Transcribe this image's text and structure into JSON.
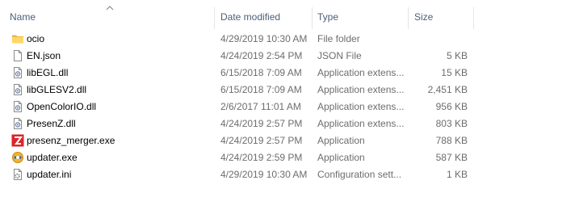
{
  "columns": {
    "name": "Name",
    "date_modified": "Date modified",
    "type": "Type",
    "size": "Size",
    "sorted_by": "Name",
    "sort_direction": "ascending"
  },
  "files": [
    {
      "name": "ocio",
      "date": "4/29/2019 10:30 AM",
      "type": "File folder",
      "size": "",
      "icon": "folder-icon"
    },
    {
      "name": "EN.json",
      "date": "4/24/2019 2:54 PM",
      "type": "JSON File",
      "size": "5 KB",
      "icon": "document-icon"
    },
    {
      "name": "libEGL.dll",
      "date": "6/15/2018 7:09 AM",
      "type": "Application extens...",
      "size": "15 KB",
      "icon": "dll-icon"
    },
    {
      "name": "libGLESV2.dll",
      "date": "6/15/2018 7:09 AM",
      "type": "Application extens...",
      "size": "2,451 KB",
      "icon": "dll-icon"
    },
    {
      "name": "OpenColorIO.dll",
      "date": "2/6/2017 11:01 AM",
      "type": "Application extens...",
      "size": "956 KB",
      "icon": "dll-icon"
    },
    {
      "name": "PresenZ.dll",
      "date": "4/24/2019 2:57 PM",
      "type": "Application extens...",
      "size": "803 KB",
      "icon": "dll-icon"
    },
    {
      "name": "presenz_merger.exe",
      "date": "4/24/2019 2:57 PM",
      "type": "Application",
      "size": "788 KB",
      "icon": "presenz-app-icon"
    },
    {
      "name": "updater.exe",
      "date": "4/24/2019 2:59 PM",
      "type": "Application",
      "size": "587 KB",
      "icon": "updater-app-icon"
    },
    {
      "name": "updater.ini",
      "date": "4/29/2019 10:30 AM",
      "type": "Configuration sett...",
      "size": "1 KB",
      "icon": "settings-file-icon"
    }
  ]
}
